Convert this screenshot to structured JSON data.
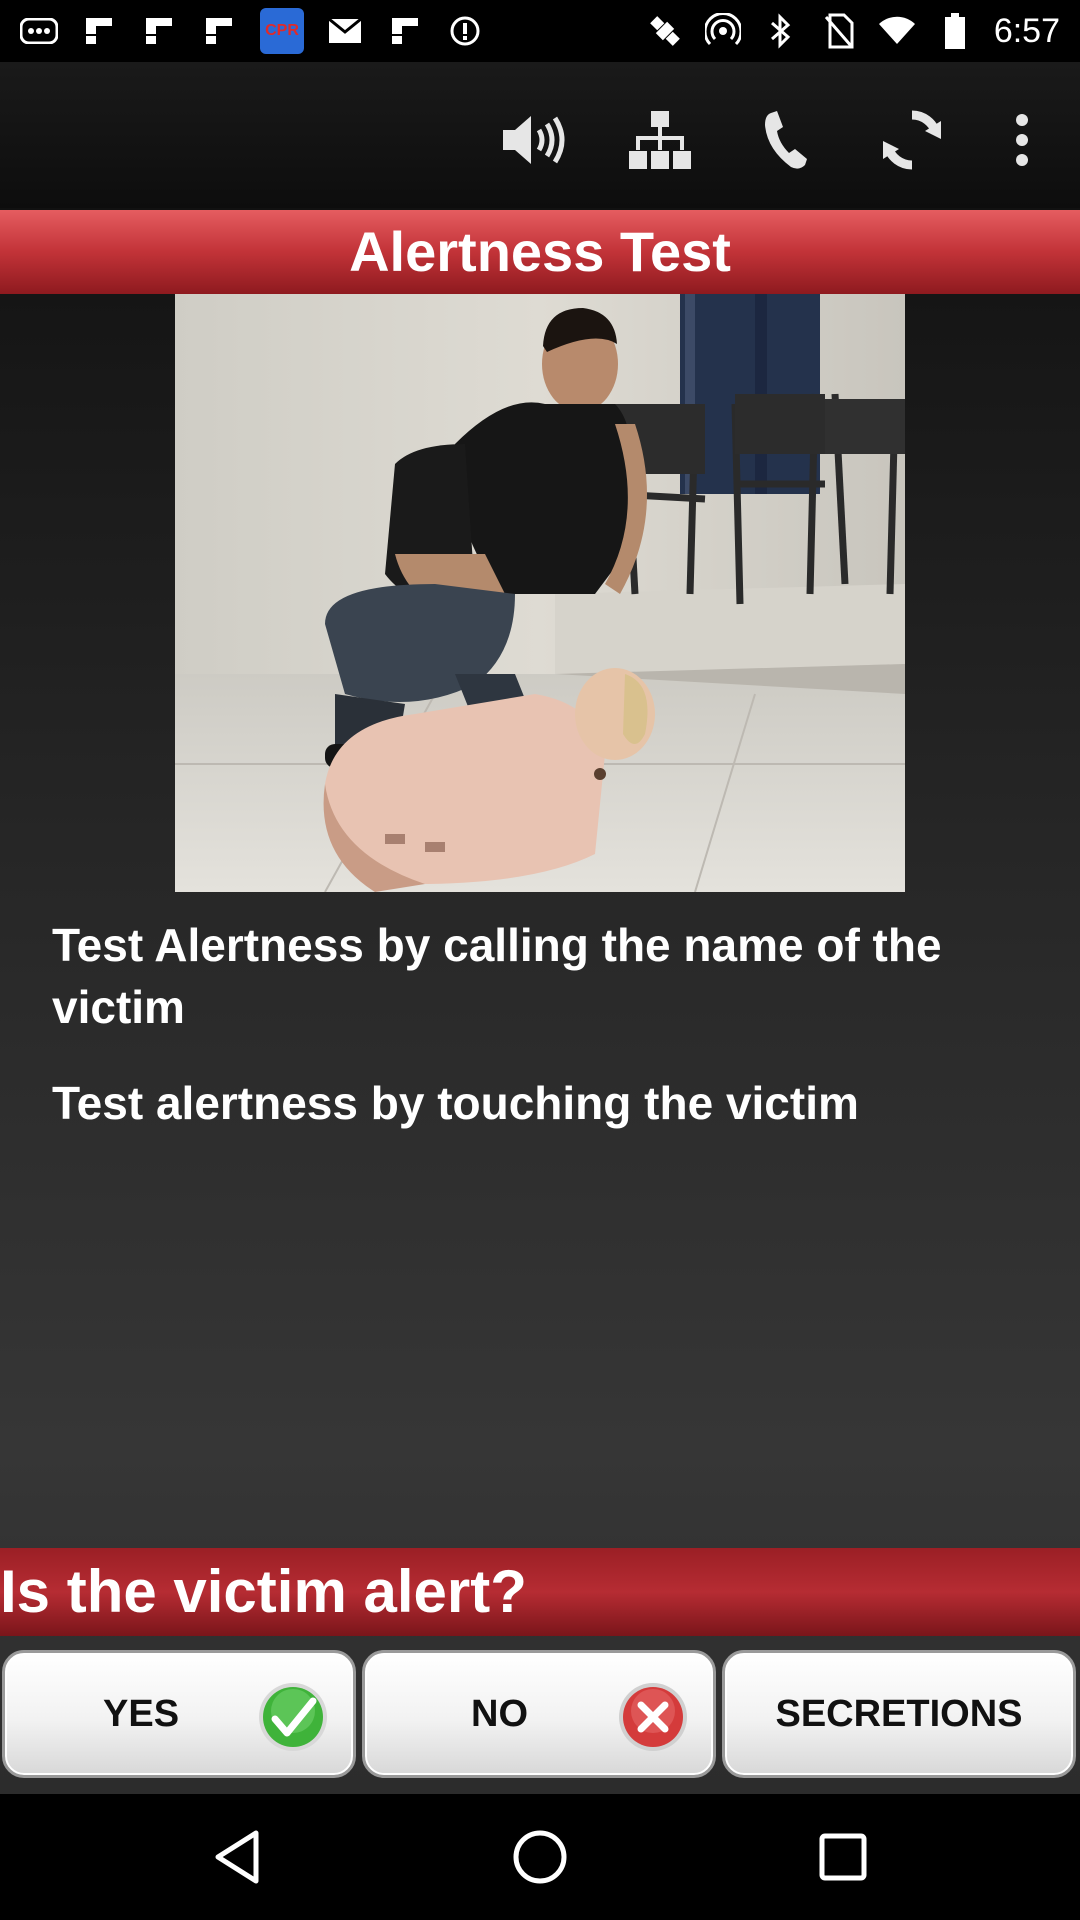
{
  "status_bar": {
    "time": "6:57",
    "left_icons": [
      "more-notifications-icon",
      "flipboard-icon",
      "flipboard-icon",
      "flipboard-icon",
      "cpr-app-icon",
      "mail-icon",
      "flipboard-icon",
      "info-icon"
    ],
    "right_icons": [
      "satellite-icon",
      "hotspot-icon",
      "bluetooth-icon",
      "no-sim-icon",
      "wifi-icon",
      "battery-icon"
    ],
    "cpr_badge": "CPR"
  },
  "toolbar": {
    "icons": [
      "volume-icon",
      "sitemap-icon",
      "phone-icon",
      "refresh-icon",
      "overflow-menu-icon"
    ]
  },
  "screen": {
    "title": "Alertness Test",
    "instructions": [
      "Test Alertness by calling the name of the victim",
      "Test alertness by touching the victim"
    ],
    "question": "Is the victim alert?"
  },
  "answers": {
    "yes": {
      "label": "YES",
      "icon": "check-icon"
    },
    "no": {
      "label": "NO",
      "icon": "close-icon"
    },
    "secretions": {
      "label": "SECRETIONS"
    }
  },
  "navbar": {
    "icons": [
      "back-icon",
      "home-icon",
      "recents-icon"
    ]
  },
  "colors": {
    "title_band": "#c23338",
    "question_band": "#9b1f25",
    "check_green": "#3fb33a",
    "close_red": "#d43b3b"
  }
}
